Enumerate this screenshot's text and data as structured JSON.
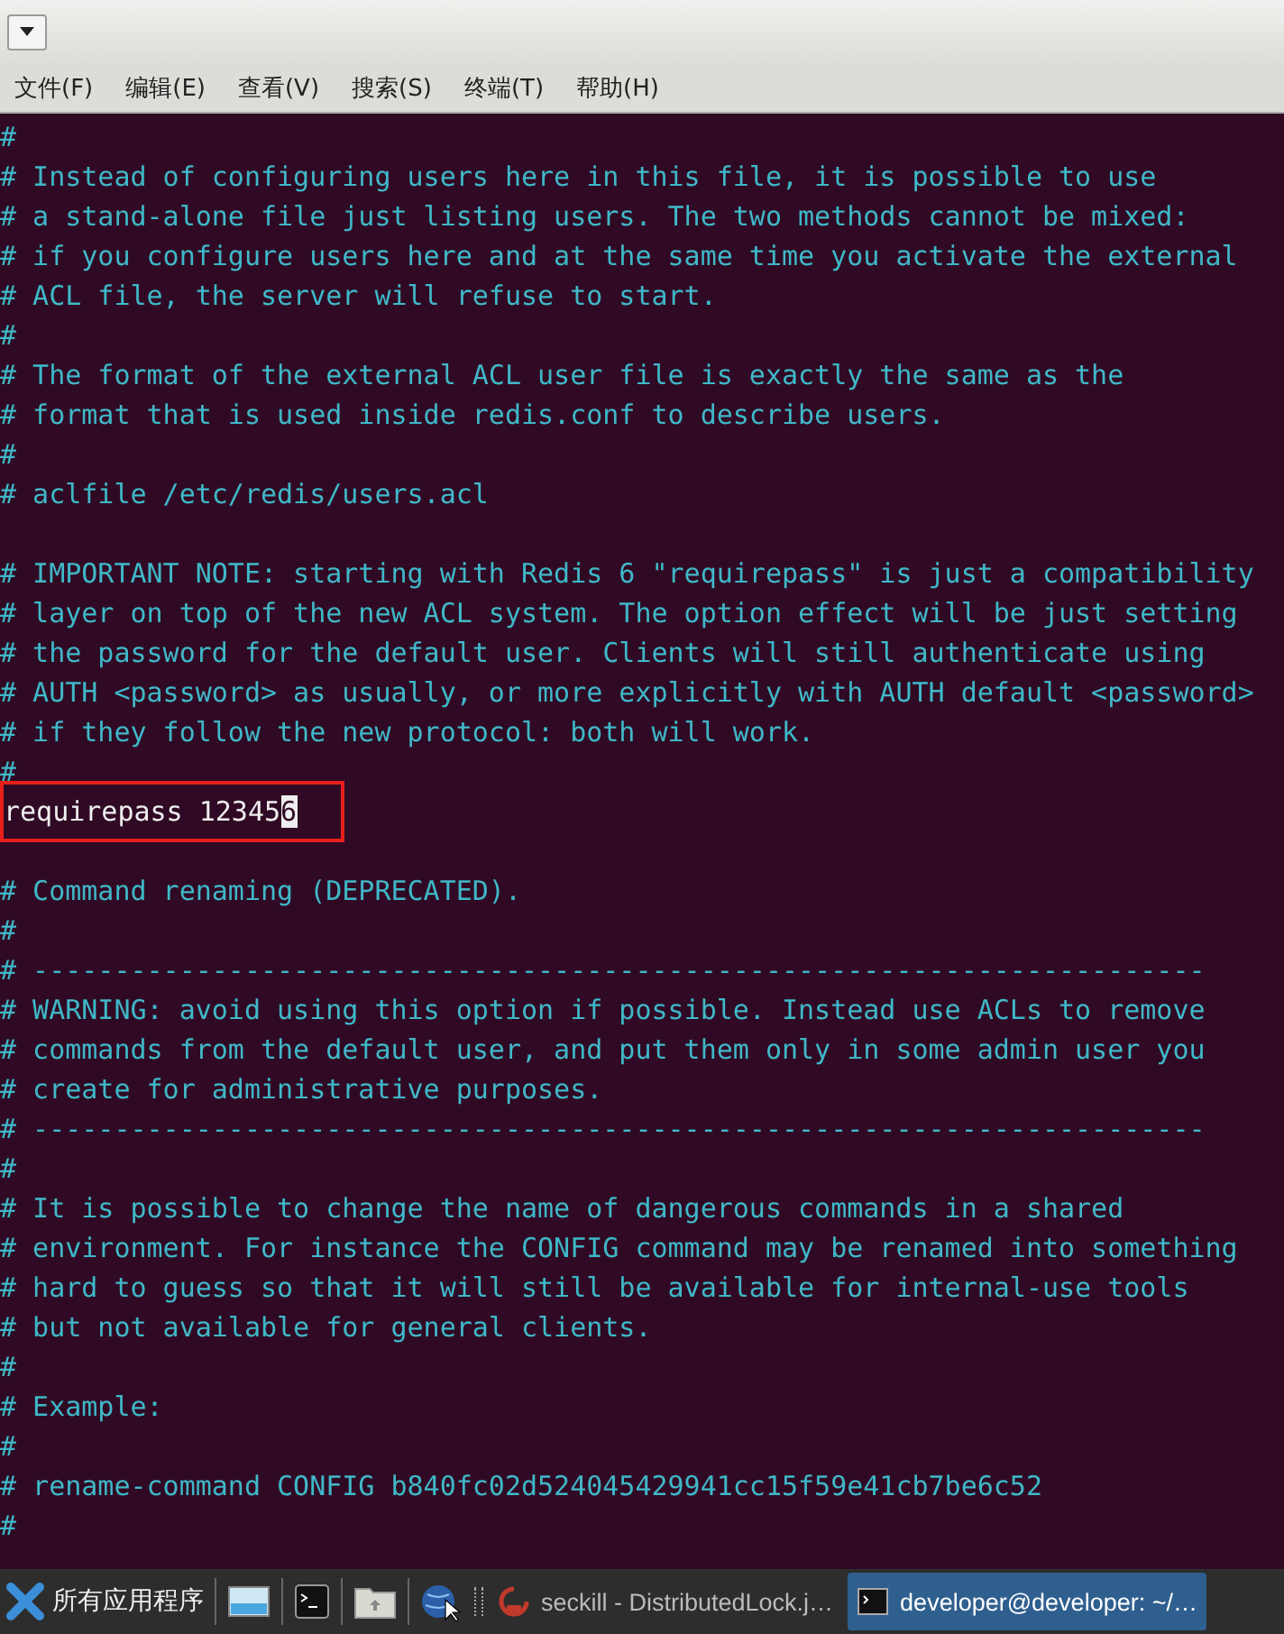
{
  "menu": [
    "文件(F)",
    "编辑(E)",
    "查看(V)",
    "搜索(S)",
    "终端(T)",
    "帮助(H)"
  ],
  "lines": [
    {
      "text": "#",
      "boxed": false
    },
    {
      "text": "# Instead of configuring users here in this file, it is possible to use",
      "boxed": false
    },
    {
      "text": "# a stand-alone file just listing users. The two methods cannot be mixed:",
      "boxed": false
    },
    {
      "text": "# if you configure users here and at the same time you activate the external",
      "boxed": false
    },
    {
      "text": "# ACL file, the server will refuse to start.",
      "boxed": false
    },
    {
      "text": "#",
      "boxed": false
    },
    {
      "text": "# The format of the external ACL user file is exactly the same as the",
      "boxed": false
    },
    {
      "text": "# format that is used inside redis.conf to describe users.",
      "boxed": false
    },
    {
      "text": "#",
      "boxed": false
    },
    {
      "text": "# aclfile /etc/redis/users.acl",
      "boxed": false
    },
    {
      "boxed": false
    },
    {
      "text": "# IMPORTANT NOTE: starting with Redis 6 \"requirepass\" is just a compatibility",
      "boxed": false
    },
    {
      "text": "# layer on top of the new ACL system. The option effect will be just setting",
      "boxed": false
    },
    {
      "text": "# the password for the default user. Clients will still authenticate using",
      "boxed": false
    },
    {
      "text": "# AUTH <password> as usually, or more explicitly with AUTH default <password>",
      "boxed": false
    },
    {
      "text": "# if they follow the new protocol: both will work.",
      "boxed": false
    },
    {
      "text": "#",
      "boxed": false
    },
    {
      "text": "requirepass 12345",
      "cursor": "6",
      "boxed": true
    },
    {
      "boxed": false
    },
    {
      "text": "# Command renaming (DEPRECATED).",
      "boxed": false
    },
    {
      "text": "#",
      "boxed": false
    },
    {
      "text": "# ------------------------------------------------------------------------",
      "boxed": false
    },
    {
      "text": "# WARNING: avoid using this option if possible. Instead use ACLs to remove",
      "boxed": false
    },
    {
      "text": "# commands from the default user, and put them only in some admin user you",
      "boxed": false
    },
    {
      "text": "# create for administrative purposes.",
      "boxed": false
    },
    {
      "text": "# ------------------------------------------------------------------------",
      "boxed": false
    },
    {
      "text": "#",
      "boxed": false
    },
    {
      "text": "# It is possible to change the name of dangerous commands in a shared",
      "boxed": false
    },
    {
      "text": "# environment. For instance the CONFIG command may be renamed into something",
      "boxed": false
    },
    {
      "text": "# hard to guess so that it will still be available for internal-use tools",
      "boxed": false
    },
    {
      "text": "# but not available for general clients.",
      "boxed": false
    },
    {
      "text": "#",
      "boxed": false
    },
    {
      "text": "# Example:",
      "boxed": false
    },
    {
      "text": "#",
      "boxed": false
    },
    {
      "text": "# rename-command CONFIG b840fc02d524045429941cc15f59e41cb7be6c52",
      "boxed": false
    },
    {
      "text": "#",
      "boxed": false
    }
  ],
  "taskbar": {
    "start_label": "所有应用程序",
    "tasks": [
      {
        "kind": "java",
        "label": "seckill - DistributedLock.j…",
        "selected": false
      },
      {
        "kind": "terminal",
        "label": "developer@developer: ~/…",
        "selected": true
      }
    ]
  }
}
